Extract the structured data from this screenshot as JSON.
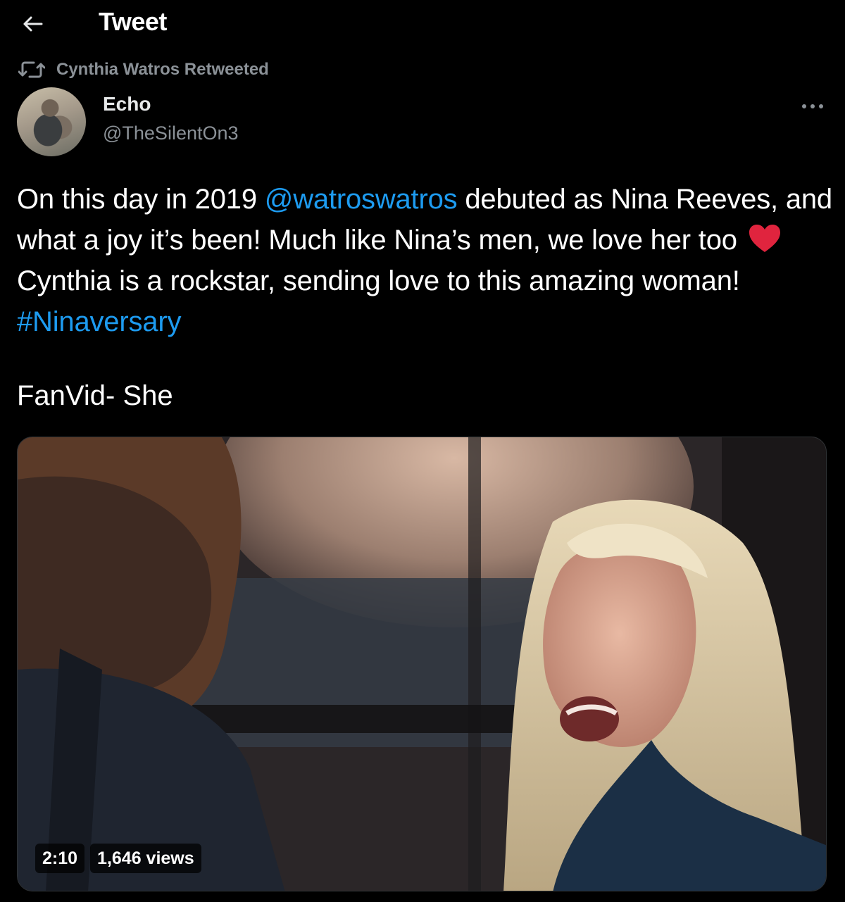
{
  "header": {
    "back_icon": "arrow-left-icon",
    "title": "Tweet"
  },
  "social_context": {
    "icon": "retweet-icon",
    "text": "Cynthia Watros Retweeted"
  },
  "author": {
    "display_name": "Echo",
    "handle": "@TheSilentOn3"
  },
  "more_icon": "more-horizontal-icon",
  "tweet": {
    "part1": "On this day in 2019 ",
    "mention": "@watroswatros",
    "part2": " debuted as Nina Reeves, and what a joy it’s been! Much like Nina’s men, we love her too ",
    "emoji": "red-heart-icon",
    "part3": " Cynthia is a rockstar, sending love to this amazing woman! ",
    "hashtag": "#Ninaversary",
    "second_paragraph": "FanVid- She"
  },
  "video": {
    "duration": "2:10",
    "views": "1,646 views"
  },
  "colors": {
    "background": "#000000",
    "link": "#1d9bf0",
    "secondary_text": "#8b9197",
    "heart": "#e0243e"
  }
}
